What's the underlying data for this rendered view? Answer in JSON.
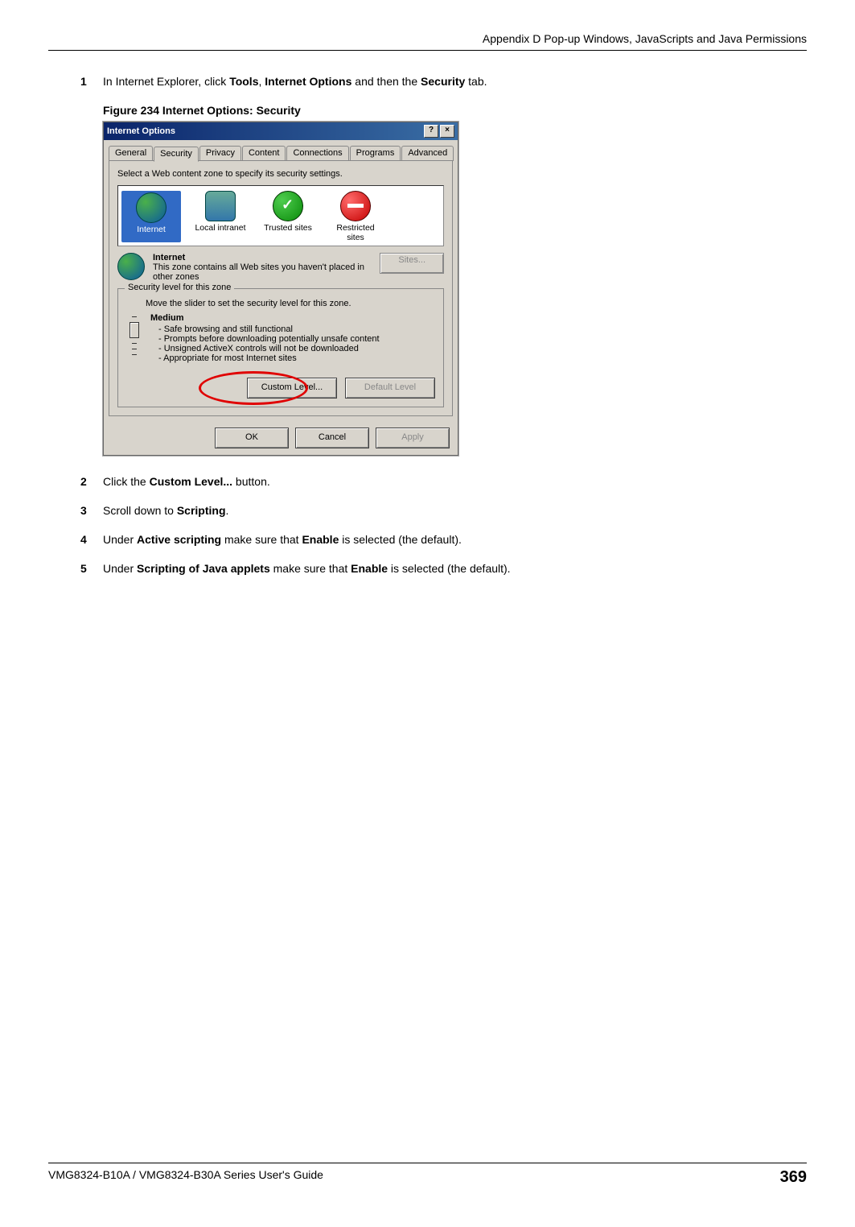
{
  "header": {
    "appendix_title": "Appendix D Pop-up Windows, JavaScripts and Java Permissions"
  },
  "steps": {
    "s1_num": "1",
    "s1_a": "In Internet Explorer, click ",
    "s1_b1": "Tools",
    "s1_c": ", ",
    "s1_b2": "Internet Options",
    "s1_d": " and then the ",
    "s1_b3": "Security",
    "s1_e": " tab.",
    "fig_label": "Figure 234   Internet Options: Security",
    "s2_num": "2",
    "s2_a": "Click the ",
    "s2_b1": "Custom Level...",
    "s2_c": " button.",
    "s3_num": "3",
    "s3_a": "Scroll down to ",
    "s3_b1": "Scripting",
    "s3_c": ".",
    "s4_num": "4",
    "s4_a": "Under ",
    "s4_b1": "Active scripting",
    "s4_c": " make sure that ",
    "s4_b2": "Enable",
    "s4_d": " is selected (the default).",
    "s5_num": "5",
    "s5_a": "Under ",
    "s5_b1": "Scripting of Java applets",
    "s5_c": " make sure that ",
    "s5_b2": "Enable",
    "s5_d": " is selected (the default)."
  },
  "dialog": {
    "title": "Internet Options",
    "help_glyph": "?",
    "close_glyph": "×",
    "tabs": {
      "general": "General",
      "security": "Security",
      "privacy": "Privacy",
      "content": "Content",
      "connections": "Connections",
      "programs": "Programs",
      "advanced": "Advanced"
    },
    "zone_instruction": "Select a Web content zone to specify its security settings.",
    "zones": {
      "internet": "Internet",
      "local": "Local intranet",
      "trusted": "Trusted sites",
      "restricted": "Restricted sites"
    },
    "zone_desc": {
      "name": "Internet",
      "text": "This zone contains all Web sites you haven't placed in other zones"
    },
    "sites_btn": "Sites...",
    "group_label": "Security level for this zone",
    "slider_instruction": "Move the slider to set the security level for this zone.",
    "level_name": "Medium",
    "bullets": {
      "b1": "- Safe browsing and still functional",
      "b2": "- Prompts before downloading potentially unsafe content",
      "b3": "- Unsigned ActiveX controls will not be downloaded",
      "b4": "- Appropriate for most Internet sites"
    },
    "custom_level_btn": "Custom Level...",
    "default_level_btn": "Default Level",
    "ok_btn": "OK",
    "cancel_btn": "Cancel",
    "apply_btn": "Apply"
  },
  "footer": {
    "guide": "VMG8324-B10A / VMG8324-B30A Series User's Guide",
    "page": "369"
  }
}
